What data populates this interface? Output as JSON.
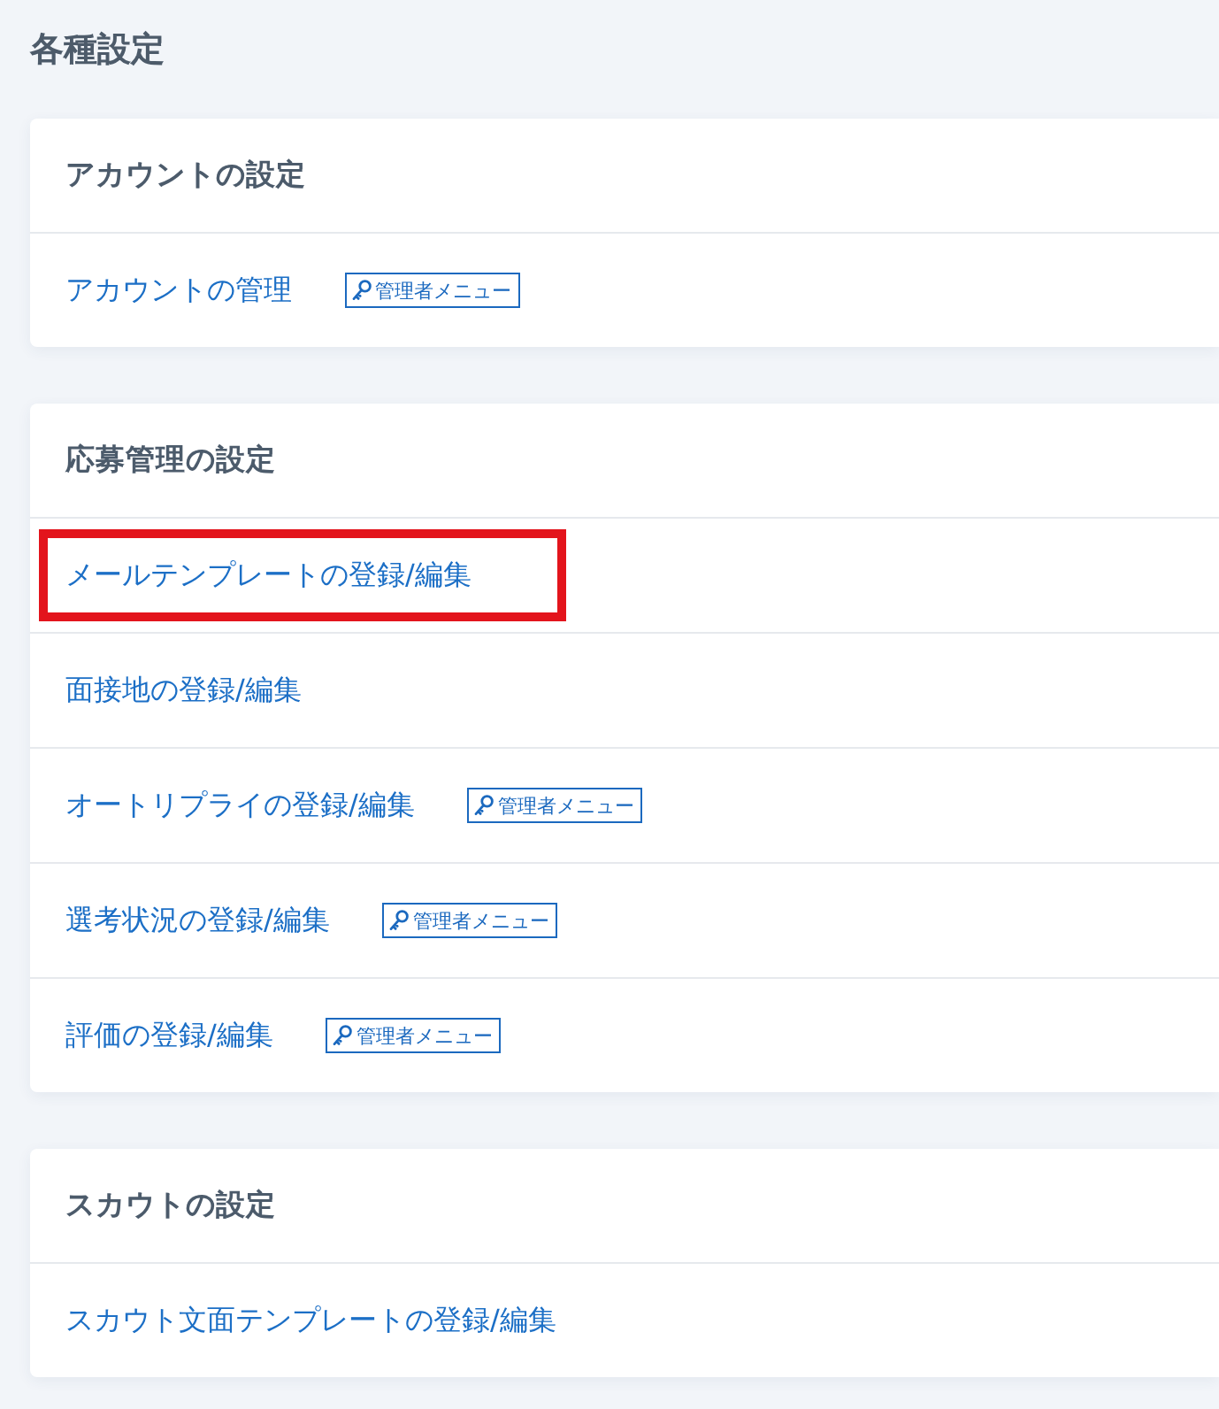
{
  "page": {
    "title": "各種設定"
  },
  "sections": [
    {
      "title": "アカウントの設定",
      "items": [
        {
          "label": "アカウントの管理",
          "highlighted": false,
          "badge": "管理者メニュー"
        }
      ]
    },
    {
      "title": "応募管理の設定",
      "items": [
        {
          "label": "メールテンプレートの登録/編集",
          "highlighted": true
        },
        {
          "label": "面接地の登録/編集",
          "highlighted": false
        },
        {
          "label": "オートリプライの登録/編集",
          "highlighted": false,
          "badge": "管理者メニュー"
        },
        {
          "label": "選考状況の登録/編集",
          "highlighted": false,
          "badge": "管理者メニュー"
        },
        {
          "label": "評価の登録/編集",
          "highlighted": false,
          "badge": "管理者メニュー"
        }
      ]
    },
    {
      "title": "スカウトの設定",
      "items": [
        {
          "label": "スカウト文面テンプレートの登録/編集",
          "highlighted": false
        }
      ]
    }
  ]
}
